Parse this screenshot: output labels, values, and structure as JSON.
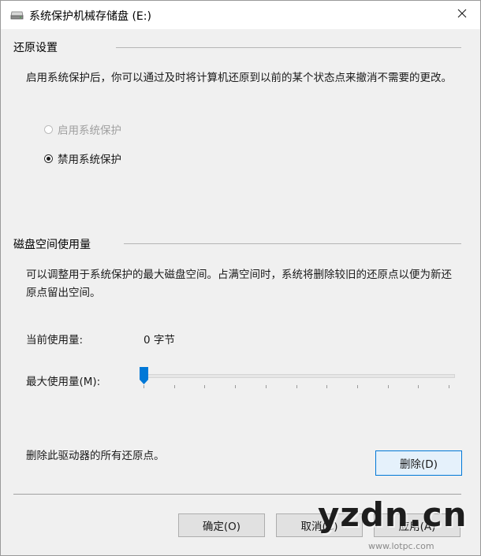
{
  "window": {
    "title": "系统保护机械存储盘 (E:)",
    "close_glyph": "✕"
  },
  "restore": {
    "header": "还原设置",
    "description": "启用系统保护后，你可以通过及时将计算机还原到以前的某个状态点来撤消不需要的更改。",
    "option_enable": "启用系统保护",
    "option_disable": "禁用系统保护",
    "selected": "option_disable"
  },
  "disk": {
    "header": "磁盘空间使用量",
    "description": "可以调整用于系统保护的最大磁盘空间。占满空间时，系统将删除较旧的还原点以便为新还原点留出空间。",
    "current_label": "当前使用量:",
    "current_value": "0 字节",
    "max_label": "最大使用量(M):",
    "slider_fraction": 0.0,
    "slider_ticks": 11,
    "delete_text": "删除此驱动器的所有还原点。",
    "delete_button": "删除(D)"
  },
  "buttons": {
    "ok": "确定(O)",
    "cancel": "取消(C)",
    "apply": "应用(A)"
  },
  "watermark": {
    "brand": "yzdn.cn",
    "site": "www.lotpc.com"
  },
  "colors": {
    "accent": "#0078d7",
    "slider_thumb": "#0078d7"
  },
  "icons": {
    "title": "drive-icon",
    "close": "close-icon"
  }
}
